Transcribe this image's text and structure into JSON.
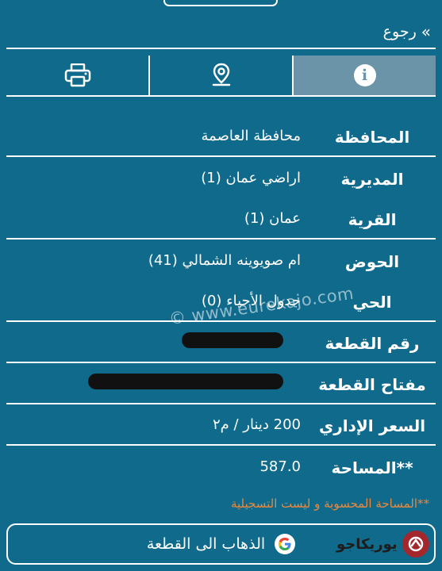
{
  "header": {
    "back_label": "رجوع",
    "back_icon": "double-chevron-right-icon"
  },
  "tabs": [
    {
      "name": "print",
      "icon": "printer-icon",
      "active": false
    },
    {
      "name": "location",
      "icon": "map-pin-icon",
      "active": false
    },
    {
      "name": "info",
      "icon": "info-icon",
      "active": true
    }
  ],
  "details": {
    "governorate": {
      "label": "المحافظة",
      "value": "محافظة العاصمة"
    },
    "directorate": {
      "label": "المديرية",
      "value": "اراضي عمان (1)"
    },
    "village": {
      "label": "القرية",
      "value": "عمان (1)"
    },
    "basin": {
      "label": "الحوض",
      "value": "ام صويوينه الشمالي (41)"
    },
    "district": {
      "label": "الحي",
      "value": "جدول الأحياء (0)"
    },
    "plot_number": {
      "label": "رقم القطعة"
    },
    "plot_key": {
      "label": "مفتاح القطعة"
    },
    "admin_price": {
      "label": "السعر الإداري",
      "value": "200 دينار / م٢"
    },
    "area": {
      "label": "**المساحة",
      "value": "587.0"
    }
  },
  "watermark": "© www.eurekajo.com",
  "note": "**المساحة المحسوبة و ليست التسجيلية",
  "go_button": {
    "label": "الذهاب الى القطعة",
    "icon": "google-icon"
  },
  "logo": {
    "text": "يوريكاجو",
    "icon": "eureka-logo-icon"
  },
  "colors": {
    "background": "#0f6a8c",
    "active_tab": "#6c94a8",
    "note": "#e8893f",
    "logo_red": "#a3282d"
  }
}
